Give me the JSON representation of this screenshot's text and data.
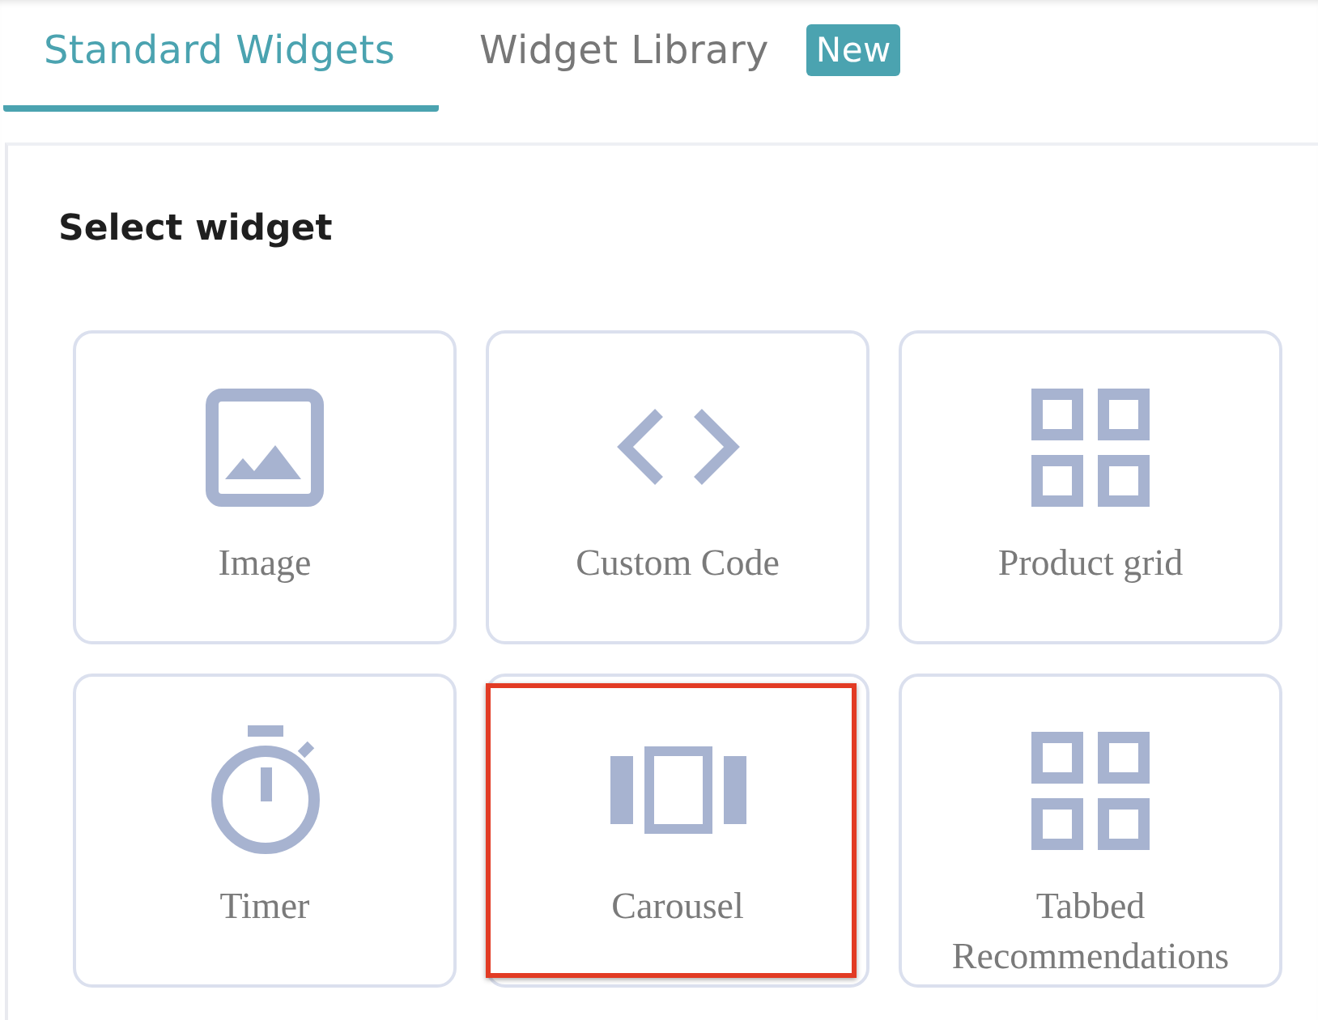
{
  "tabs": [
    {
      "label": "Standard Widgets",
      "selected": true
    },
    {
      "label": "Widget Library",
      "selected": false,
      "badge": "New"
    }
  ],
  "panel": {
    "title": "Select widget"
  },
  "widgets": [
    {
      "label": "Image",
      "kind": "image",
      "highlighted": false
    },
    {
      "label": "Custom Code",
      "kind": "code",
      "highlighted": false
    },
    {
      "label": "Product grid",
      "kind": "grid",
      "highlighted": false
    },
    {
      "label": "Timer",
      "kind": "timer",
      "highlighted": false
    },
    {
      "label": "Carousel",
      "kind": "carousel",
      "highlighted": true
    },
    {
      "label": "Tabbed Recommendations",
      "kind": "grid",
      "highlighted": false
    }
  ]
}
